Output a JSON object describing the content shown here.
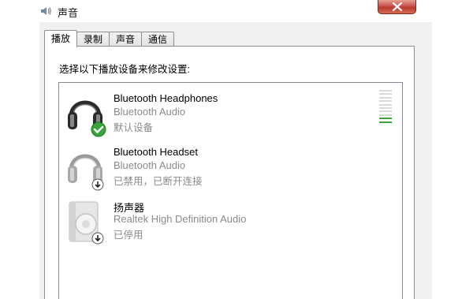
{
  "window": {
    "title": "声音"
  },
  "tabs": [
    {
      "label": "播放",
      "active": true
    },
    {
      "label": "录制",
      "active": false
    },
    {
      "label": "声音",
      "active": false
    },
    {
      "label": "通信",
      "active": false
    }
  ],
  "instruction": "选择以下播放设备来修改设置:",
  "devices": [
    {
      "name": "Bluetooth Headphones",
      "driver": "Bluetooth Audio",
      "status": "默认设备",
      "icon": "headphones-icon",
      "badge": "default-check-icon"
    },
    {
      "name": "Bluetooth Headset",
      "driver": "Bluetooth Audio",
      "status": "已禁用，已断开连接",
      "icon": "headset-icon",
      "badge": "down-arrow-icon"
    },
    {
      "name": "扬声器",
      "driver": "Realtek High Definition Audio",
      "status": "已停用",
      "icon": "speaker-icon",
      "badge": "down-arrow-icon"
    }
  ],
  "level_meter": {
    "segments": 10,
    "lit_segments": 2
  },
  "colors": {
    "accent_green": "#3aa33a",
    "close_red": "#c75050",
    "muted_text": "#8a8a8a"
  }
}
